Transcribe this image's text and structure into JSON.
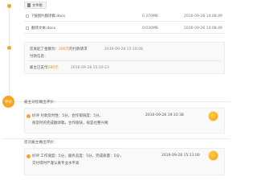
{
  "files": {
    "header_label": "文件框",
    "items": [
      {
        "name": "7张图片翻译稿.docx",
        "size": "0.370MB",
        "date": "2016-09-28 14:08:49"
      },
      {
        "name": "翻译文本.docx",
        "size": "0.030MB",
        "date": "2016-09-28 14:08:49"
      }
    ]
  },
  "payment": {
    "request_prefix": "您发起了金额为：",
    "amount": "280元",
    "request_suffix": "的付款请求",
    "request_date": "2016-09-28 15:10:08",
    "info_label": "付款信息：",
    "paid_prefix": "雇主已支付",
    "paid_amount": "280元",
    "paid_date": "2016-09-28 15:10:23"
  },
  "evaluation": {
    "badge_label": "评价",
    "employer_section_title": "雇主对您做出评价：",
    "employer_review": {
      "rating_line": "好评  付款及时性：5分，合作愉快度：5分，",
      "comment": "很及时的完成翻译稿，合作愉快，很是也整兴啊",
      "date": "2016-09-28 19:33:38"
    },
    "my_section_title": "您对雇主做出评价：",
    "my_review": {
      "rating_line": "好评  工作速度：5分，服务态度：5分，完成质量：5分，",
      "comment": "交付得时严谨认真专业水平高",
      "date": "2016-09-28 15:11:00"
    }
  }
}
